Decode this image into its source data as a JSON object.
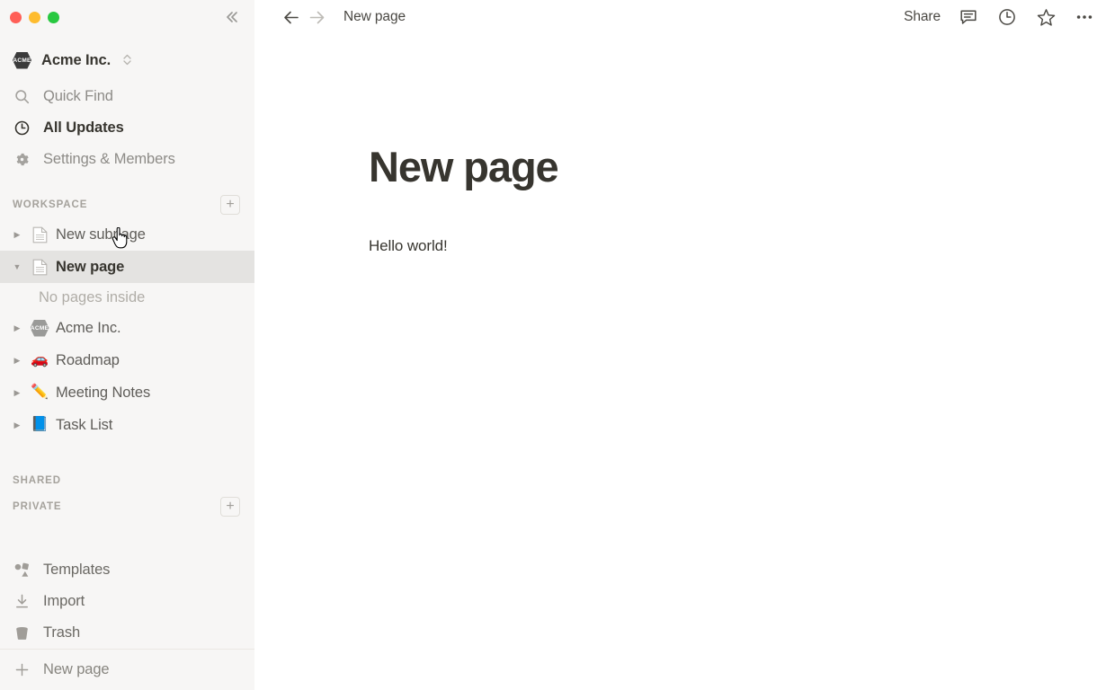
{
  "window": {
    "traffic_lights": [
      "close",
      "minimize",
      "maximize"
    ],
    "collapse_label": "«"
  },
  "sidebar": {
    "workspace": {
      "name": "Acme Inc.",
      "badge_text": "ACME",
      "switcher_icon": "chevron-up-down-icon"
    },
    "nav": [
      {
        "label": "Quick Find",
        "icon": "search-icon",
        "active": false
      },
      {
        "label": "All Updates",
        "icon": "clock-icon",
        "active": true
      },
      {
        "label": "Settings & Members",
        "icon": "gear-icon",
        "active": false
      }
    ],
    "sections": {
      "workspace": {
        "title": "WORKSPACE",
        "add_label": "+",
        "pages": [
          {
            "label": "New subpage",
            "icon": "document-icon",
            "emoji": "",
            "expanded": false,
            "selected": false,
            "triangle": "▶"
          },
          {
            "label": "New page",
            "icon": "document-icon",
            "emoji": "",
            "expanded": true,
            "selected": true,
            "triangle": "▼"
          },
          {
            "label": "Acme Inc.",
            "icon": "acme-badge-icon",
            "emoji": "",
            "expanded": false,
            "selected": false,
            "triangle": "▶"
          },
          {
            "label": "Roadmap",
            "icon": "emoji-icon",
            "emoji": "🚗",
            "expanded": false,
            "selected": false,
            "triangle": "▶"
          },
          {
            "label": "Meeting Notes",
            "icon": "emoji-icon",
            "emoji": "✏️",
            "expanded": false,
            "selected": false,
            "triangle": "▶"
          },
          {
            "label": "Task List",
            "icon": "emoji-icon",
            "emoji": "📘",
            "expanded": false,
            "selected": false,
            "triangle": "▶"
          }
        ],
        "empty_child_label": "No pages inside"
      },
      "shared": {
        "title": "SHARED"
      },
      "private": {
        "title": "PRIVATE",
        "add_label": "+"
      }
    },
    "utilities": [
      {
        "label": "Templates",
        "icon": "templates-icon"
      },
      {
        "label": "Import",
        "icon": "import-icon"
      },
      {
        "label": "Trash",
        "icon": "trash-icon"
      }
    ],
    "footer": {
      "label": "New page",
      "icon": "plus-icon"
    }
  },
  "topbar": {
    "back_icon": "arrow-left-icon",
    "forward_icon": "arrow-right-icon",
    "breadcrumb": "New page",
    "share_label": "Share",
    "icons": [
      {
        "name": "comment-icon"
      },
      {
        "name": "history-clock-icon"
      },
      {
        "name": "star-icon"
      },
      {
        "name": "more-options-icon"
      }
    ]
  },
  "page": {
    "title": "New page",
    "paragraph": "Hello world!"
  },
  "colors": {
    "sidebar_bg": "#f7f6f5",
    "selected_row": "#e4e3e1",
    "text_primary": "#37352f",
    "text_muted": "#8d8b87",
    "traffic_red": "#ff5f57",
    "traffic_yellow": "#febc2e",
    "traffic_green": "#28c840"
  }
}
